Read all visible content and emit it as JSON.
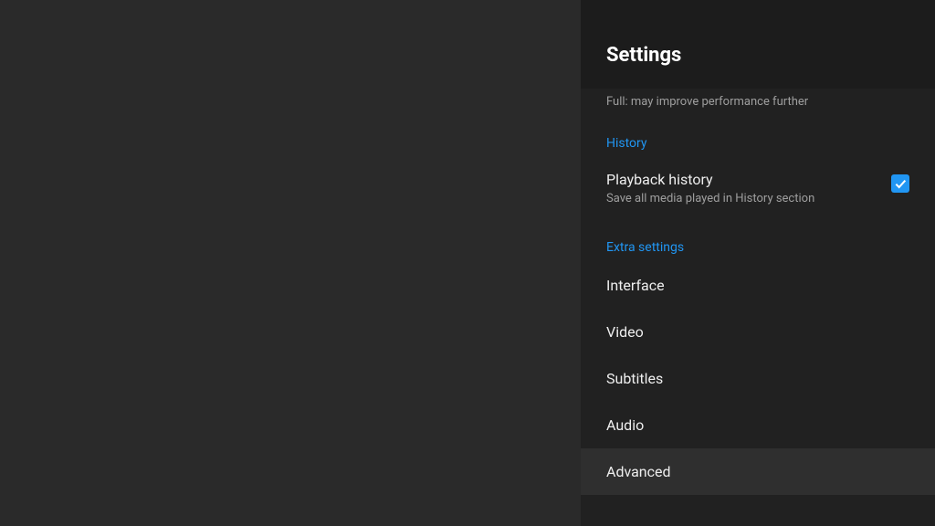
{
  "header": {
    "title": "Settings"
  },
  "partial_description": "Full: may improve performance further",
  "sections": {
    "history": {
      "header": "History",
      "playback": {
        "title": "Playback history",
        "subtitle": "Save all media played in History section",
        "checked": true
      }
    },
    "extra": {
      "header": "Extra settings",
      "items": {
        "interface": "Interface",
        "video": "Video",
        "subtitles": "Subtitles",
        "audio": "Audio",
        "advanced": "Advanced"
      }
    }
  }
}
